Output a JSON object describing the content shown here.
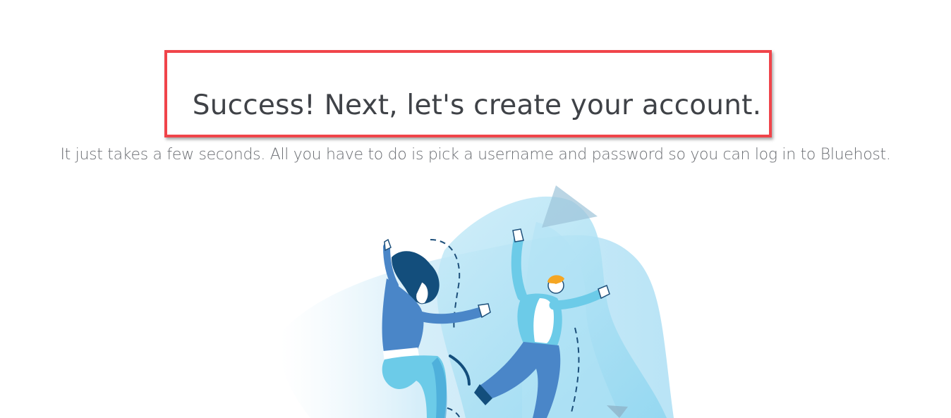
{
  "main": {
    "headline": "Success! Next, let's create your account.",
    "subtext": "It just takes a few seconds. All you have to do is pick a username and password so you can log in to Bluehost.",
    "illustration": {
      "icon": "celebrating-people-illustration"
    }
  },
  "annotation": {
    "color": "#f0444a"
  },
  "colors": {
    "text_primary": "#3f4247",
    "text_secondary": "#6b6e73",
    "blue_dark": "#1d5a8c",
    "blue_mid": "#4a86c8",
    "blue_light": "#6ccbe8",
    "orange": "#f5a623"
  }
}
